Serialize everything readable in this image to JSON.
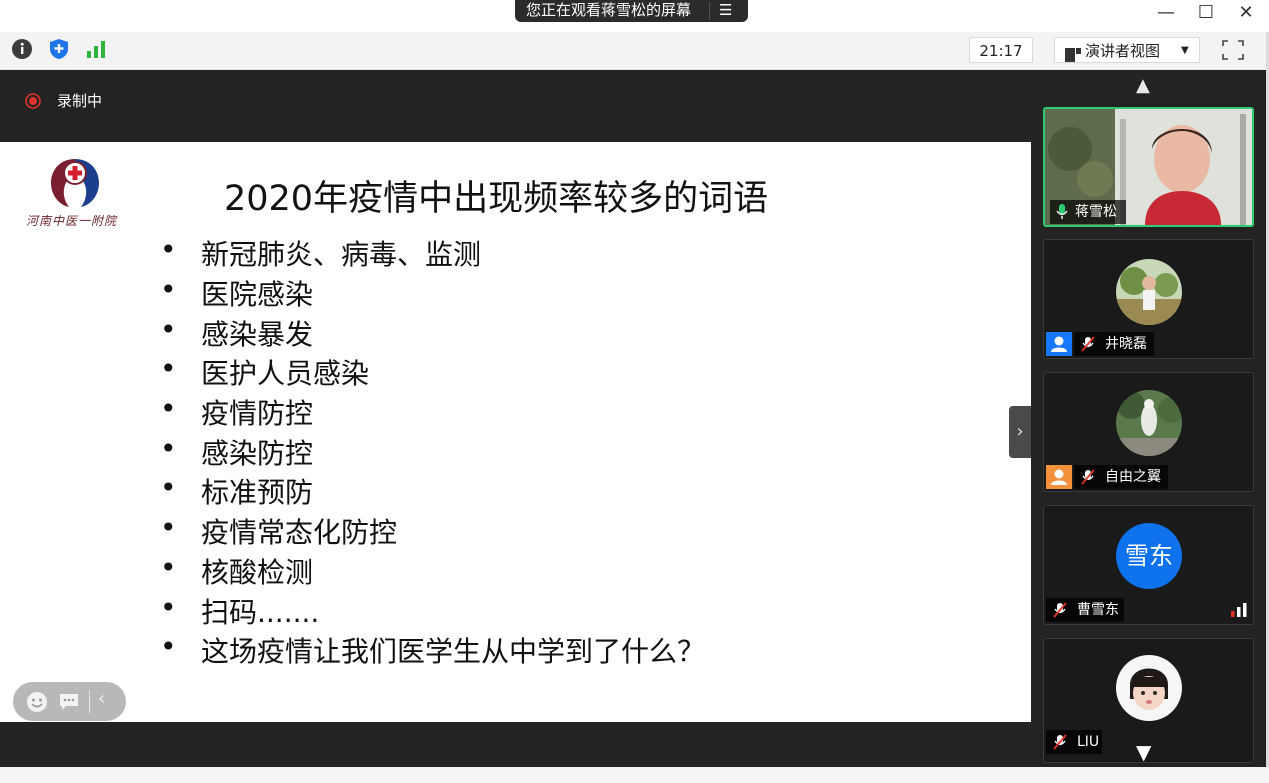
{
  "window": {
    "screen_share_banner": "您正在观看蒋雪松的屏幕",
    "minimize_glyph": "—",
    "maximize_glyph": "☐",
    "close_glyph": "✕"
  },
  "toolbar": {
    "clock": "21:17",
    "view_mode_label": "演讲者视图",
    "view_mode_caret": "▼",
    "icons": [
      "info-icon",
      "shield-icon",
      "signal-icon",
      "fullscreen-icon"
    ]
  },
  "recording": {
    "label": "录制中"
  },
  "slide": {
    "hospital_name": "河南中医一附院",
    "title": "2020年疫情中出现频率较多的词语",
    "bullet_symbol": "•",
    "bullets": [
      "新冠肺炎、病毒、监测",
      "医院感染",
      "感染暴发",
      "医护人员感染",
      "疫情防控",
      "感染防控",
      "标准预防",
      "疫情常态化防控",
      "核酸检测",
      "扫码.......",
      "这场疫情让我们医学生从中学到了什么？"
    ]
  },
  "sidebar": {
    "scroll_up_glyph": "▲",
    "scroll_down_glyph": "▼",
    "collapse_glyph": "›",
    "participants": [
      {
        "name": "蒋雪松",
        "mic": "on",
        "video": true,
        "active_speaker": true
      },
      {
        "name": "井晓磊",
        "mic": "muted",
        "video": false,
        "role_badge": "blue"
      },
      {
        "name": "自由之翼",
        "mic": "muted",
        "video": false,
        "role_badge": "orange"
      },
      {
        "name": "曹雪东",
        "mic": "muted",
        "video": false,
        "avatar_text": "雪东"
      },
      {
        "name": "LIU",
        "mic": "muted",
        "video": false
      }
    ]
  },
  "colors": {
    "accent_green": "#2ecc71",
    "avatar_blue": "#0e72ed",
    "recording_red": "#e0332b",
    "badge_orange": "#f4923c"
  }
}
